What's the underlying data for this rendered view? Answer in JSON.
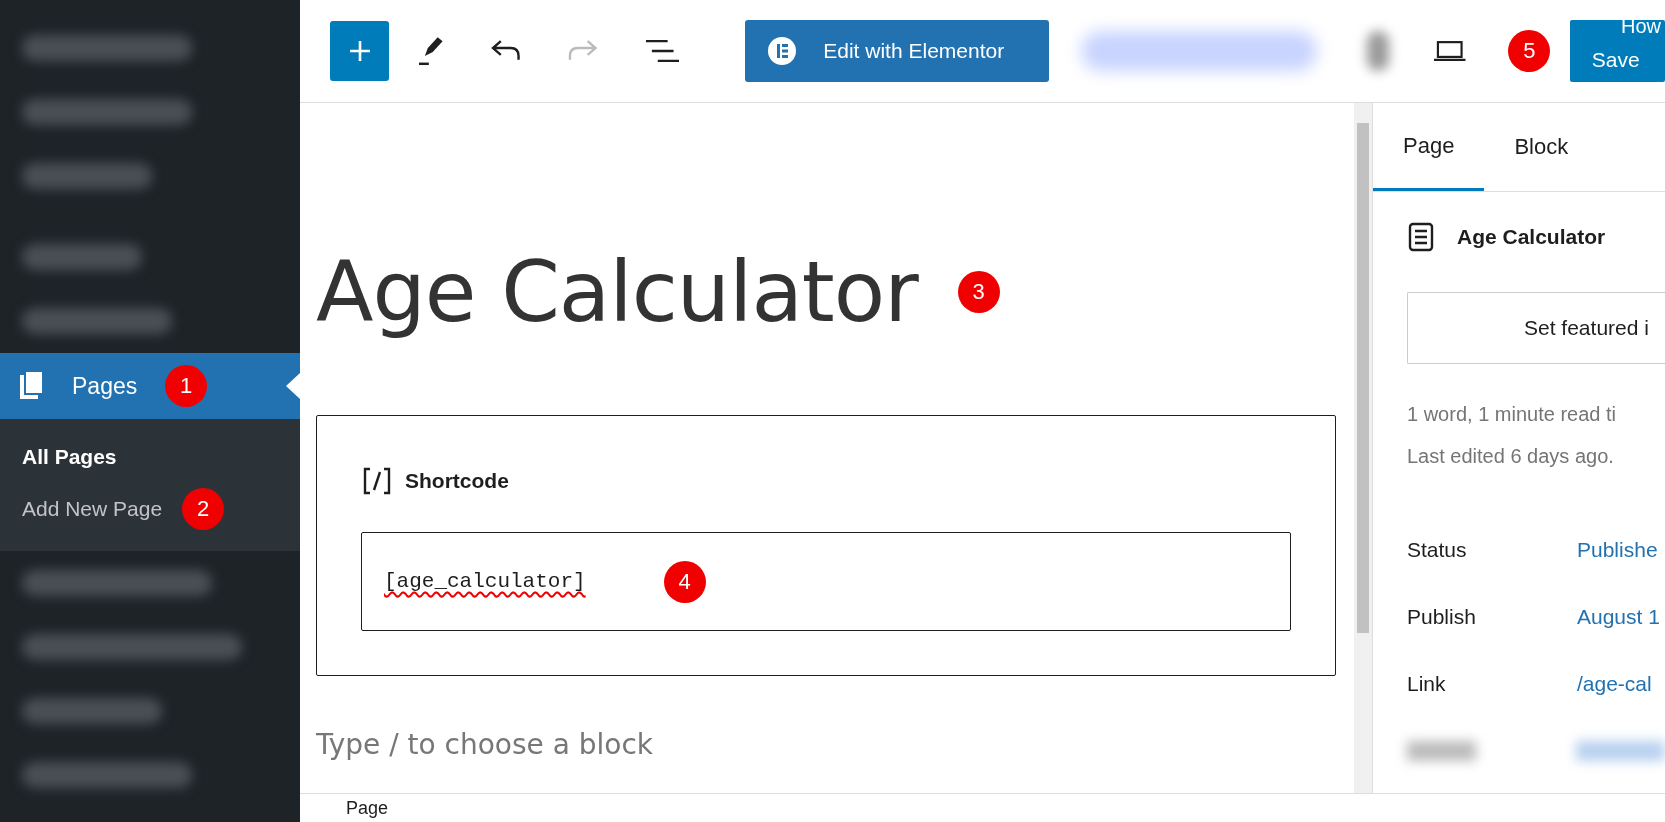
{
  "sidebar": {
    "items": [
      {
        "label": "Pages",
        "selected": true,
        "marker": "1"
      }
    ],
    "submenu": [
      {
        "label": "All Pages",
        "selected": true
      },
      {
        "label": "Add New Page",
        "selected": false,
        "marker": "2"
      }
    ]
  },
  "toolbar": {
    "tools": [
      {
        "kind": "add",
        "disabled": false
      },
      {
        "kind": "tools",
        "disabled": false
      },
      {
        "kind": "undo",
        "disabled": false
      },
      {
        "kind": "redo",
        "disabled": true
      },
      {
        "kind": "outline",
        "disabled": false
      }
    ],
    "elementor_button": "Edit with Elementor",
    "marker": "5",
    "save_button": "Save",
    "cut_text": "How"
  },
  "editor": {
    "title": "Age Calculator",
    "title_marker": "3",
    "block_label": "Shortcode",
    "shortcode": "[age_calculator]",
    "shortcode_marker": "4",
    "placeholder": "Type / to choose a block",
    "breadcrumb": "Page"
  },
  "panel": {
    "tabs": [
      {
        "label": "Page",
        "selected": true
      },
      {
        "label": "Block",
        "selected": false
      }
    ],
    "page_title": "Age Calculator",
    "featured_button": "Set featured i",
    "stats": "1 word, 1 minute read ti",
    "last_edited": "Last edited 6 days ago.",
    "rows": [
      {
        "label": "Status",
        "value": "Publishe"
      },
      {
        "label": "Publish",
        "value": "August 1"
      },
      {
        "label": "Link",
        "value": "/age-cal"
      }
    ]
  }
}
